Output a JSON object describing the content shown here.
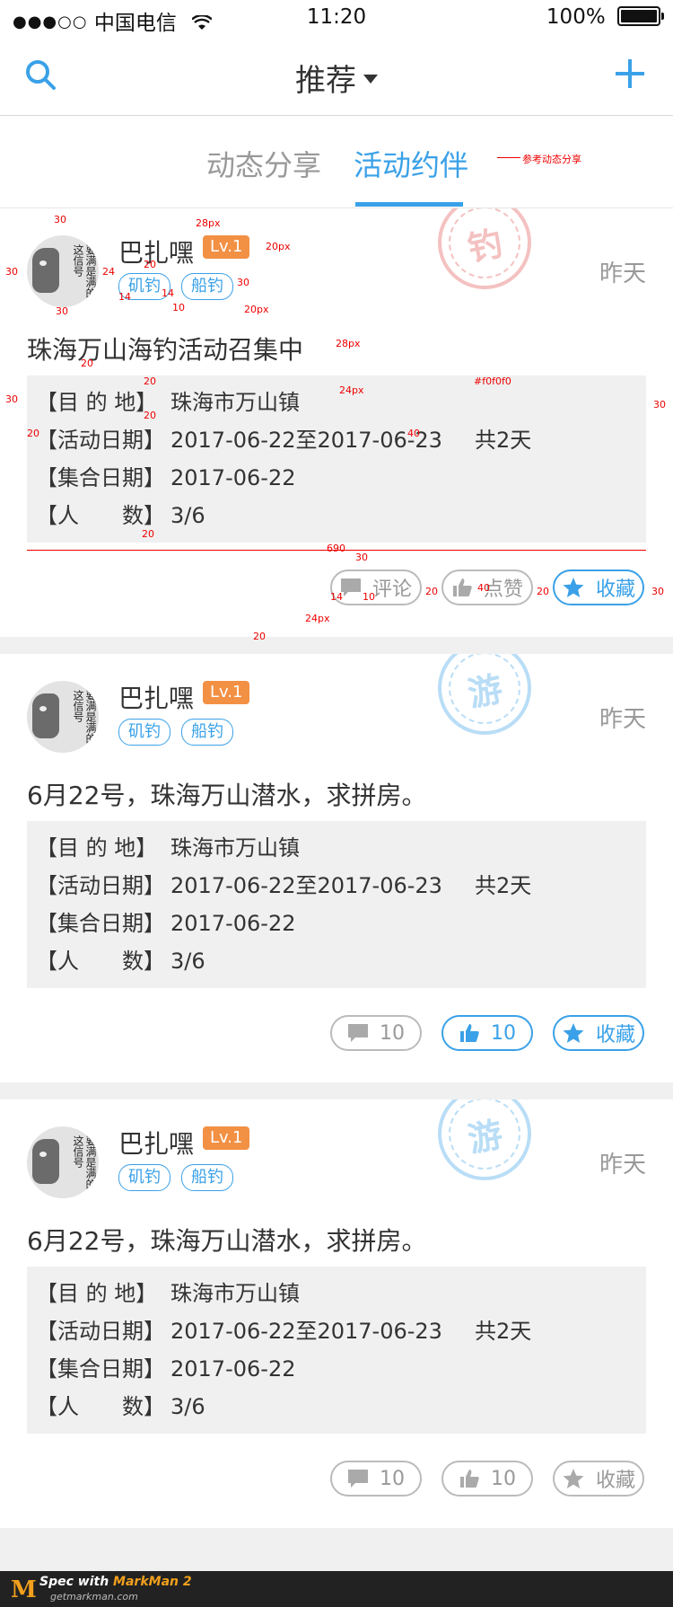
{
  "status": {
    "carrier": "中国电信",
    "time": "11:20",
    "battery": "100%"
  },
  "nav": {
    "title": "推荐"
  },
  "tabs": [
    {
      "label": "动态分享"
    },
    {
      "label": "活动约伴"
    }
  ],
  "annotations": {
    "tab_note": "参考动态分享",
    "title_size": "28px",
    "lv_gap": "20px",
    "tag_gap": "20px",
    "box_font": "24px",
    "color_note": "#f0f0f0",
    "box_width": "690",
    "btn_font": "24px",
    "section_gap": "20",
    "pad30": "30",
    "pad24": "24",
    "pad14": "14",
    "pad10": "10",
    "pad20": "20",
    "pad40": "40"
  },
  "labels": {
    "dest": "【目 的 地】",
    "act_date": "【活动日期】",
    "meet_date": "【集合日期】",
    "people": "【人　　数】"
  },
  "cards": [
    {
      "user": "巴扎嘿",
      "level": "Lv.1",
      "tags": [
        "矶钓",
        "船钓"
      ],
      "time": "昨天",
      "stamp": "钓",
      "title": "珠海万山海钓活动召集中",
      "dest": "珠海市万山镇",
      "act_date": "2017-06-22至2017-06-23",
      "duration": "共2天",
      "meet_date": "2017-06-22",
      "people": "3/6",
      "comment": "评论",
      "like": "点赞",
      "fav": "收藏"
    },
    {
      "user": "巴扎嘿",
      "level": "Lv.1",
      "tags": [
        "矶钓",
        "船钓"
      ],
      "time": "昨天",
      "stamp": "游",
      "title": "6月22号，珠海万山潜水，求拼房。",
      "dest": "珠海市万山镇",
      "act_date": "2017-06-22至2017-06-23",
      "duration": "共2天",
      "meet_date": "2017-06-22",
      "people": "3/6",
      "comment": "10",
      "like": "10",
      "fav": "收藏"
    },
    {
      "user": "巴扎嘿",
      "level": "Lv.1",
      "tags": [
        "矶钓",
        "船钓"
      ],
      "time": "昨天",
      "stamp": "游",
      "title": "6月22号，珠海万山潜水，求拼房。",
      "dest": "珠海市万山镇",
      "act_date": "2017-06-22至2017-06-23",
      "duration": "共2天",
      "meet_date": "2017-06-22",
      "people": "3/6",
      "comment": "10",
      "like": "10",
      "fav": "收藏"
    }
  ],
  "footer": {
    "spec_with": "Spec with",
    "brand": "MarkMan 2",
    "url": "getmarkman.com"
  },
  "colors": {
    "accent": "#3aa1e8",
    "level": "#f29044",
    "box": "#f0f0f0"
  }
}
